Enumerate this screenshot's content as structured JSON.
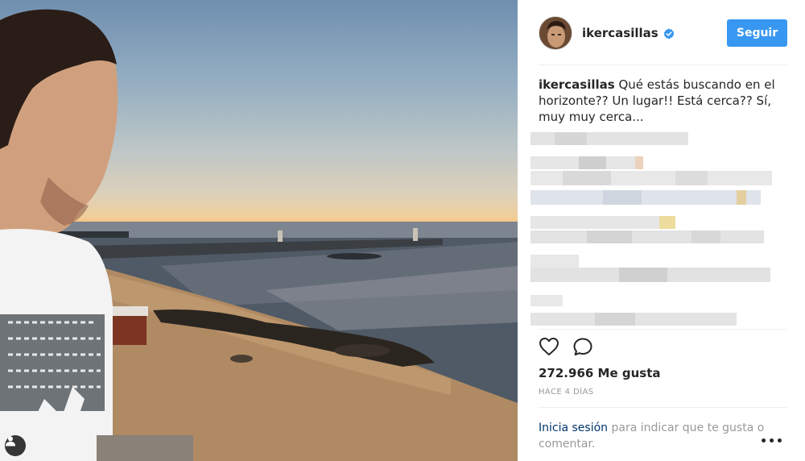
{
  "post": {
    "username": "ikercasillas",
    "follow_label": "Seguir",
    "caption_author": "ikercasillas",
    "caption_text": "Qué estás buscando en el horizonte?? Un lugar!! Está cerca?? Sí, muy muy cerca...",
    "likes": "272.966 Me gusta",
    "timestamp": "HACE 4 DÍAS",
    "login_link": "Inicia sesión",
    "login_text": " para indicar que te gusta o comentar.",
    "more_options": "•••"
  },
  "colors": {
    "accent": "#3897f0",
    "verified": "#3897f0",
    "link": "#003569",
    "muted": "#999999"
  },
  "icons": {
    "like": "heart-outline-icon",
    "comment": "comment-bubble-icon",
    "verified": "verified-badge-icon",
    "user_tag": "person-tag-icon",
    "more": "ellipsis-icon"
  }
}
